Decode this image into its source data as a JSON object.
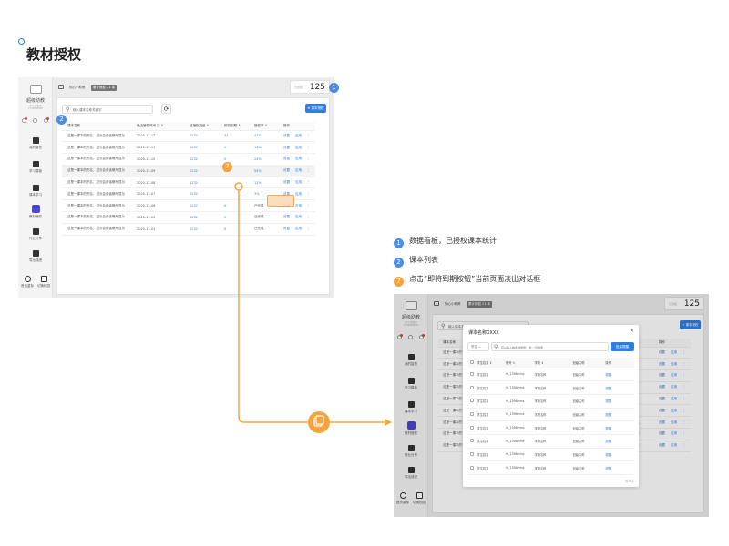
{
  "page": {
    "title": "教材授权"
  },
  "legend": [
    {
      "num": "1",
      "text": "数据看板，已授权课本统计"
    },
    {
      "num": "2",
      "text": "课本列表"
    },
    {
      "num": "7",
      "text": "点击“即将到期按钮”当前页面淡出对话框"
    }
  ],
  "app": {
    "brand": "超级助教",
    "tiny1": "超小·德鲁伊",
    "tiny2": "1738888888",
    "school": "知心小助教",
    "tag": "累计授权 21 本",
    "stat_label": "已授权",
    "stat_value": "125",
    "nav": [
      "我的智慧",
      "学习模板",
      "课本学习",
      "教材授权",
      "作业分享",
      "导出成绩"
    ],
    "bottom_nav": [
      "首页重标",
      "切换校园"
    ],
    "search_placeholder": "输入课本名称关键字",
    "add_button": "课本授权",
    "columns": [
      "课本名称",
      "最近授权时间",
      "已授权班级",
      "即将到期",
      "授权率",
      "操作"
    ],
    "rows": [
      {
        "name": "这是一课本的书名，过长会用省略号显示",
        "date": "2020-12-12",
        "classes": "1232",
        "expiring": "32",
        "rate": "42%"
      },
      {
        "name": "这是一课本的书名，过长会用省略号显示",
        "date": "2020-12-11",
        "classes": "1232",
        "expiring": "0",
        "rate": "13%"
      },
      {
        "name": "这是一课本的书名，过长会用省略号显示",
        "date": "2020-12-10",
        "classes": "1232",
        "expiring": "0",
        "rate": "24%"
      },
      {
        "name": "这是一课本的书名，过长会用省略号显示",
        "date": "2020-12-09",
        "classes": "1232",
        "expiring": "32",
        "rate": "55%"
      },
      {
        "name": "这是一课本的书名，过长会用省略号显示",
        "date": "2020-12-08",
        "classes": "1232",
        "expiring": "",
        "rate": "12%"
      },
      {
        "name": "这是一课本的书名，过长会用省略号显示",
        "date": "2020-12-07",
        "classes": "1232",
        "expiring": "",
        "rate": "3%"
      },
      {
        "name": "这是一课本的书名，过长会用省略号显示",
        "date": "2020-12-06",
        "classes": "1232",
        "expiring": "0",
        "rate": "已完成"
      },
      {
        "name": "这是一课本的书名，过长会用省略号显示",
        "date": "2020-12-05",
        "classes": "1232",
        "expiring": "0",
        "rate": "已完成"
      },
      {
        "name": "这是一课本的书名，过长会用省略号显示",
        "date": "2020-12-04",
        "classes": "1232",
        "expiring": "0",
        "rate": "已完成"
      }
    ],
    "row_actions": [
      "设置",
      "应用"
    ],
    "more": "⋮"
  },
  "modal": {
    "title": "课本名称XXXX",
    "close": "×",
    "select": "学生",
    "search_placeholder": "可以输入姓名或学号，用“,”可搜索",
    "button": "批量提醒",
    "columns": [
      "学生姓名",
      "账号",
      "学校",
      "班级名称",
      "操作"
    ],
    "rows": [
      {
        "name": "学生姓名",
        "acc": "fs_1396mms",
        "school": "学校名称",
        "cls": "班级名称",
        "op": "提醒"
      },
      {
        "name": "学生姓名",
        "acc": "fs_1396mms",
        "school": "学校名称",
        "cls": "班级名称",
        "op": "提醒"
      },
      {
        "name": "学生姓名",
        "acc": "fs_1396mms",
        "school": "学校名称",
        "cls": "班级名称",
        "op": "提醒"
      },
      {
        "name": "学生姓名",
        "acc": "fs_1396mms",
        "school": "学校名称",
        "cls": "班级名称",
        "op": "提醒"
      },
      {
        "name": "学生姓名",
        "acc": "fs_1396mms",
        "school": "学校名称",
        "cls": "班级名称",
        "op": "提醒"
      },
      {
        "name": "学生姓名",
        "acc": "fs_1396mms",
        "school": "学校名称",
        "cls": "班级名称",
        "op": "提醒"
      },
      {
        "name": "学生姓名",
        "acc": "fs_1396mms",
        "school": "学校名称",
        "cls": "班级名称",
        "op": "提醒"
      },
      {
        "name": "学生姓名",
        "acc": "fs_1396mms",
        "school": "学校名称",
        "cls": "班级名称",
        "op": "提醒"
      }
    ],
    "pager": "共 8 人"
  },
  "colors": {
    "accent": "#2f7fe0",
    "badge": "#4a8ee8",
    "orange": "#f5a33c",
    "active_nav": "#4a46d8"
  }
}
